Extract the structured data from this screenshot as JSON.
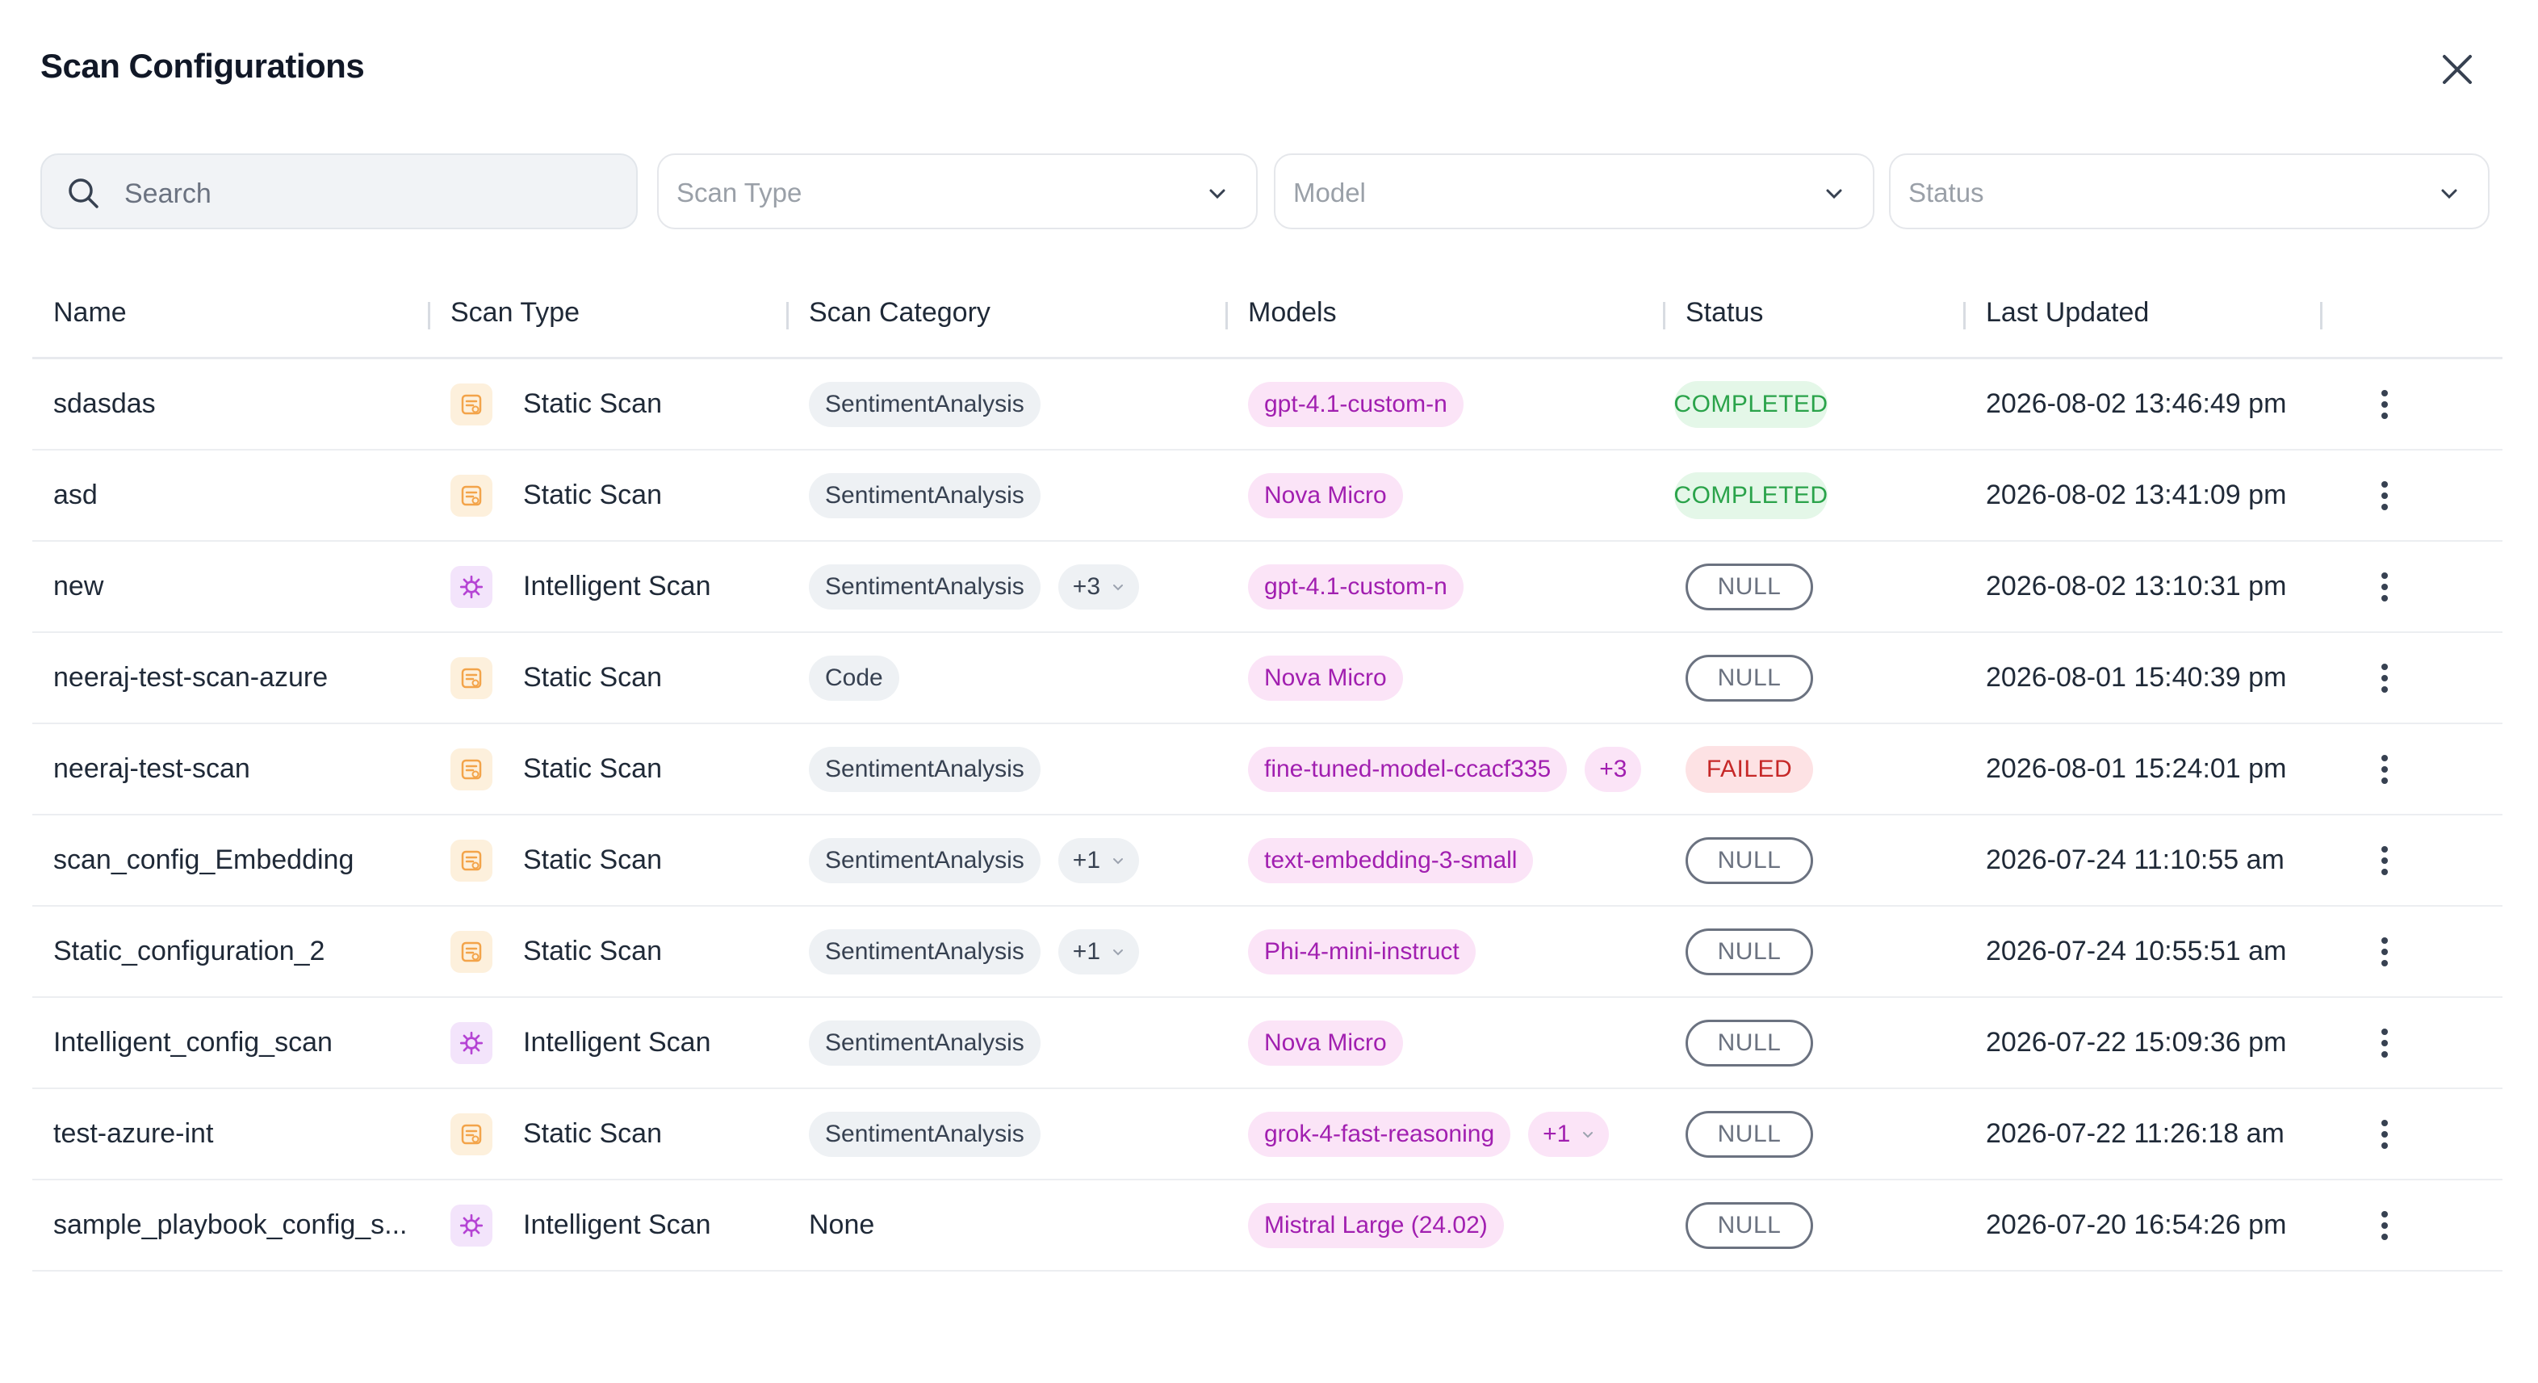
{
  "title": "Scan Configurations",
  "filters": {
    "search_placeholder": "Search",
    "scan_type_placeholder": "Scan Type",
    "model_placeholder": "Model",
    "status_placeholder": "Status"
  },
  "columns": [
    "Name",
    "Scan Type",
    "Scan Category",
    "Models",
    "Status",
    "Last Updated"
  ],
  "rows": [
    {
      "name": "sdasdas",
      "scan_type": "Static Scan",
      "type_icon": "static-scan-icon",
      "category": "SentimentAnalysis",
      "category_more": "",
      "model": "gpt-4.1-custom-n",
      "model_more": "",
      "status": "COMPLETED",
      "updated": "2026-08-02 13:46:49 pm"
    },
    {
      "name": "asd",
      "scan_type": "Static Scan",
      "type_icon": "static-scan-icon",
      "category": "SentimentAnalysis",
      "category_more": "",
      "model": "Nova Micro",
      "model_more": "",
      "status": "COMPLETED",
      "updated": "2026-08-02 13:41:09 pm"
    },
    {
      "name": "new",
      "scan_type": "Intelligent Scan",
      "type_icon": "intelligent-scan-icon",
      "category": "SentimentAnalysis",
      "category_more": "+3",
      "model": "gpt-4.1-custom-n",
      "model_more": "",
      "status": "NULL",
      "updated": "2026-08-02 13:10:31 pm"
    },
    {
      "name": "neeraj-test-scan-azure",
      "scan_type": "Static Scan",
      "type_icon": "static-scan-icon",
      "category": "Code",
      "category_more": "",
      "model": "Nova Micro",
      "model_more": "",
      "status": "NULL",
      "updated": "2026-08-01 15:40:39 pm"
    },
    {
      "name": "neeraj-test-scan",
      "scan_type": "Static Scan",
      "type_icon": "static-scan-icon",
      "category": "SentimentAnalysis",
      "category_more": "",
      "model": "fine-tuned-model-ccacf335",
      "model_more": "+3",
      "status": "FAILED",
      "updated": "2026-08-01 15:24:01 pm"
    },
    {
      "name": "scan_config_Embedding",
      "scan_type": "Static Scan",
      "type_icon": "static-scan-icon",
      "category": "SentimentAnalysis",
      "category_more": "+1",
      "model": "text-embedding-3-small",
      "model_more": "",
      "status": "NULL",
      "updated": "2026-07-24 11:10:55 am"
    },
    {
      "name": "Static_configuration_2",
      "scan_type": "Static Scan",
      "type_icon": "static-scan-icon",
      "category": "SentimentAnalysis",
      "category_more": "+1",
      "model": "Phi-4-mini-instruct",
      "model_more": "",
      "status": "NULL",
      "updated": "2026-07-24 10:55:51 am"
    },
    {
      "name": "Intelligent_config_scan",
      "scan_type": "Intelligent Scan",
      "type_icon": "intelligent-scan-icon",
      "category": "SentimentAnalysis",
      "category_more": "",
      "model": "Nova Micro",
      "model_more": "",
      "status": "NULL",
      "updated": "2026-07-22 15:09:36 pm"
    },
    {
      "name": "test-azure-int",
      "scan_type": "Static Scan",
      "type_icon": "static-scan-icon",
      "category": "SentimentAnalysis",
      "category_more": "",
      "model": "grok-4-fast-reasoning",
      "model_more": "+1",
      "status": "NULL",
      "updated": "2026-07-22 11:26:18 am"
    },
    {
      "name": "sample_playbook_config_s...",
      "scan_type": "Intelligent Scan",
      "type_icon": "intelligent-scan-icon",
      "category": "None",
      "category_more": "",
      "model": "Mistral Large (24.02)",
      "model_more": "",
      "status": "NULL",
      "updated": "2026-07-20 16:54:26 pm"
    }
  ],
  "colors": {
    "static_icon": "#f3a44a",
    "intelligent_icon": "#b544d4",
    "completed": "#2aa34a",
    "failed": "#c62828",
    "model_chip": "#a11fb0"
  }
}
